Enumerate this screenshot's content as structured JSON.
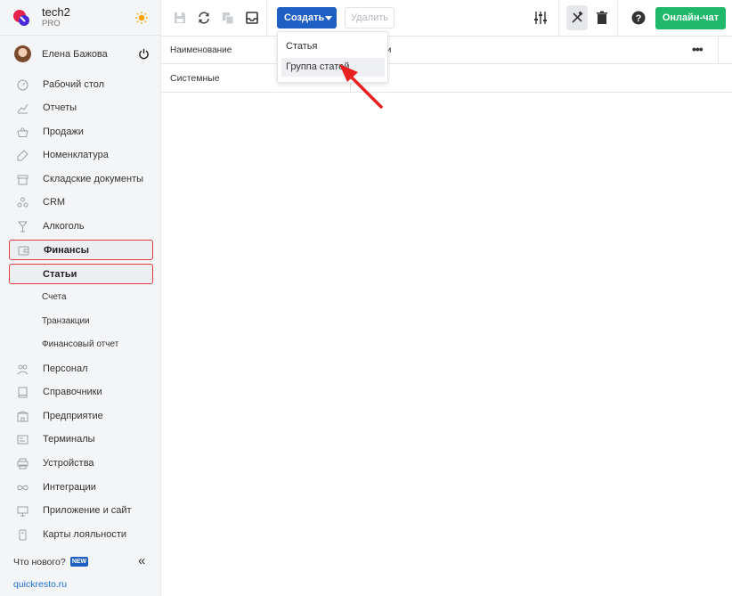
{
  "brand": {
    "name": "tech2",
    "plan": "PRO",
    "accent": "#1d5fc2"
  },
  "user": {
    "name": "Елена Бажова"
  },
  "sidebar": {
    "items": [
      {
        "label": "Рабочий стол",
        "icon": "dashboard-icon"
      },
      {
        "label": "Отчеты",
        "icon": "chart-icon"
      },
      {
        "label": "Продажи",
        "icon": "basket-icon"
      },
      {
        "label": "Номенклатура",
        "icon": "tag-icon"
      },
      {
        "label": "Складские документы",
        "icon": "box-icon"
      },
      {
        "label": "CRM",
        "icon": "people-icon"
      },
      {
        "label": "Алкоголь",
        "icon": "glass-icon"
      },
      {
        "label": "Финансы",
        "icon": "wallet-icon"
      },
      {
        "label": "Статьи"
      },
      {
        "label": "Счета"
      },
      {
        "label": "Транзакции"
      },
      {
        "label": "Финансовый отчет"
      },
      {
        "label": "Персонал",
        "icon": "staff-icon"
      },
      {
        "label": "Справочники",
        "icon": "book-icon"
      },
      {
        "label": "Предприятие",
        "icon": "building-icon"
      },
      {
        "label": "Терминалы",
        "icon": "terminal-icon"
      },
      {
        "label": "Устройства",
        "icon": "printer-icon"
      },
      {
        "label": "Интеграции",
        "icon": "infinity-icon"
      },
      {
        "label": "Приложение и сайт",
        "icon": "monitor-icon"
      },
      {
        "label": "Карты лояльности",
        "icon": "card-icon"
      }
    ],
    "whats_new": "Что нового?",
    "new_badge": "NEW",
    "site": "quickresto.ru"
  },
  "toolbar": {
    "create_label": "Создать",
    "delete_label": "Удалить",
    "chat_label": "Онлайн-чат"
  },
  "dropdown": {
    "items": [
      "Статья",
      "Группа статей"
    ]
  },
  "table": {
    "columns": [
      "Наименование",
      "тьи"
    ],
    "rows": [
      [
        "Системные",
        ""
      ]
    ]
  },
  "colors": {
    "highlight": "#e23b3b",
    "chat": "#20b96b",
    "link": "#1d6fd1"
  }
}
